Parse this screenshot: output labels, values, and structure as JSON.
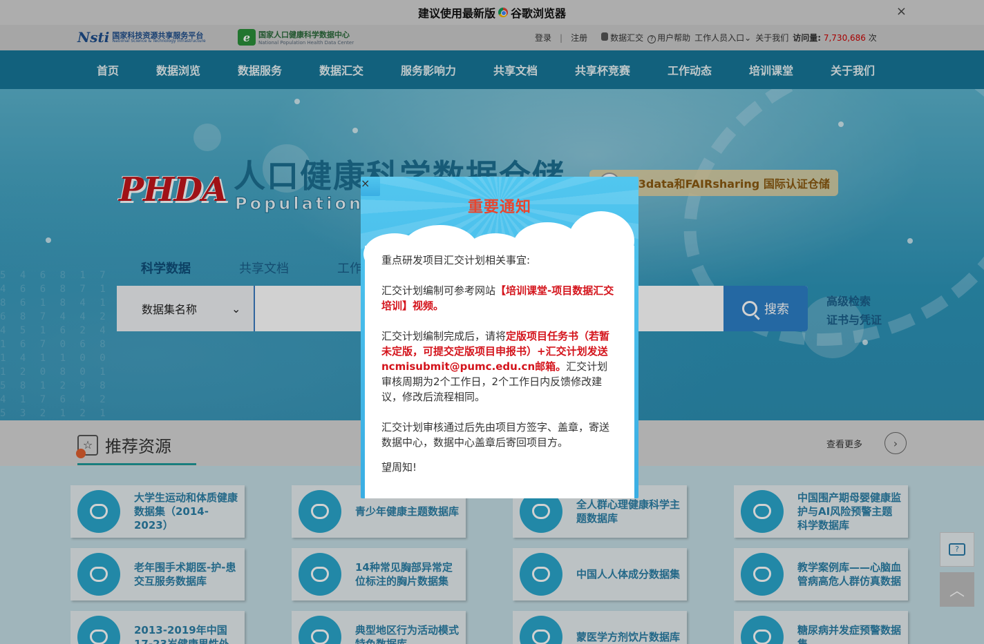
{
  "banner": {
    "text_before": "建议使用最新版",
    "text_after": "谷歌浏览器",
    "close": "×"
  },
  "header": {
    "logo1": {
      "mark": "Nsti",
      "cn": "国家科技资源共享服务平台",
      "en": "National Science & Technology Infrastructure"
    },
    "logo2": {
      "mark": "e",
      "cn": "国家人口健康科学数据中心",
      "en": "National Population Health Data Center"
    },
    "login": "登录",
    "sep": "|",
    "register": "注册",
    "data_submit": "数据汇交",
    "help": "用户帮助",
    "staff": "工作人员入口",
    "about": "关于我们",
    "visits_label": "访问量:",
    "visits_count": "7,730,686",
    "visits_unit": "次"
  },
  "nav": [
    "首页",
    "数据浏览",
    "数据服务",
    "数据汇交",
    "服务影响力",
    "共享文档",
    "共享杯竞赛",
    "工作动态",
    "培训课堂",
    "关于我们"
  ],
  "hero": {
    "logo": "PHDA",
    "title": "人口健康科学数据仓储",
    "subtitle": "Population Health",
    "badge": "re3data和FAIRsharing 国际认证仓储",
    "tabs": [
      "科学数据",
      "共享文档",
      "工作"
    ],
    "search_select": "数据集名称",
    "search_placeholder": "",
    "search_button": "搜索",
    "advanced": "高级检索",
    "cert": "证书与凭证"
  },
  "section": {
    "title": "推荐资源",
    "more": "查看更多",
    "arrow": "›"
  },
  "cards": [
    "大学生运动和体质健康数据集（2014-2023）",
    "青少年健康主题数据库",
    "全人群心理健康科学主题数据库",
    "中国围产期母婴健康监护与AI风险预警主题科学数据库",
    "老年围手术期医-护-患交互服务数据库",
    "14种常见胸部异常定位标注的胸片数据集",
    "中国人人体成分数据集",
    "教学案例库——心脑血管病高危人群仿真数据",
    "2013-2019年中国17-23岁健康男性外",
    "典型地区行为活动模式特色数据库",
    "蒙医学方剂饮片数据库",
    "糖尿病并发症预警数据集"
  ],
  "float": {
    "chat": "?",
    "top": "︿"
  },
  "modal": {
    "title": "重要通知",
    "close": "×",
    "p1": "重点研发项目汇交计划相关事宜:",
    "p2_a": "汇交计划编制可参考网站",
    "p2_b": "【培训课堂-项目数据汇交培训】视频。",
    "p3_a": "汇交计划编制完成后，请将",
    "p3_b": "定版项目任务书（若暂未定版，可提交定版项目申报书）+汇交计划发送ncmisubmit@pumc.edu.cn邮箱。",
    "p3_c": "汇交计划审核周期为2个工作日，2个工作日内反馈修改建议，修改后流程相同。",
    "p4": "汇交计划审核通过后先由项目方签字、盖章，寄送数据中心，数据中心盖章后寄回项目方。",
    "p5": "望周知!"
  }
}
